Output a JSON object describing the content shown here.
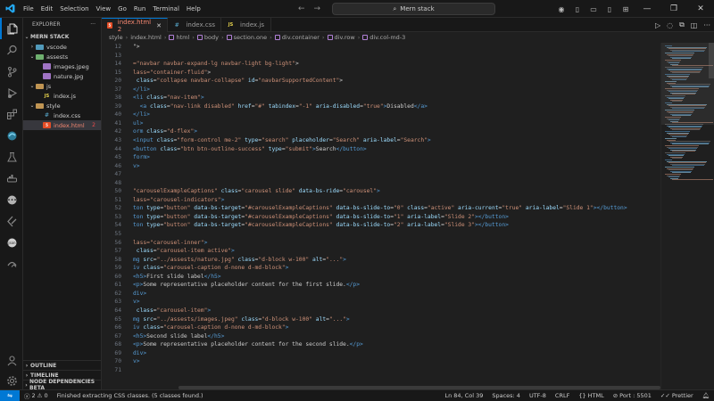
{
  "menu": [
    "File",
    "Edit",
    "Selection",
    "View",
    "Go",
    "Run",
    "Terminal",
    "Help"
  ],
  "search": {
    "text": "Mern stack"
  },
  "sidebar": {
    "title": "EXPLORER",
    "root": "MERN STACK",
    "items": [
      {
        "label": "vscode",
        "type": "folder",
        "level": 1
      },
      {
        "label": "assests",
        "type": "folder",
        "level": 1
      },
      {
        "label": "images.jpeg",
        "type": "image",
        "level": 2
      },
      {
        "label": "nature.jpg",
        "type": "image",
        "level": 2
      },
      {
        "label": "js",
        "type": "folder",
        "level": 1
      },
      {
        "label": "index.js",
        "type": "js",
        "level": 2
      },
      {
        "label": "style",
        "type": "folder",
        "level": 1
      },
      {
        "label": "index.css",
        "type": "css",
        "level": 2
      },
      {
        "label": "index.html",
        "type": "html",
        "level": 2,
        "errors": "2"
      }
    ],
    "sections": [
      "OUTLINE",
      "TIMELINE",
      "NODE DEPENDENCIES BETA"
    ]
  },
  "tabs": [
    {
      "label": "index.html 2",
      "type": "html",
      "active": true
    },
    {
      "label": "index.css",
      "type": "css",
      "active": false
    },
    {
      "label": "index.js",
      "type": "js",
      "active": false
    }
  ],
  "breadcrumb": [
    "style",
    "index.html",
    "html",
    "body",
    "section.one",
    "div.container",
    "div.row",
    "div.col-md-3"
  ],
  "code_lines": [
    {
      "n": "12",
      "parts": [
        [
          "txt",
          "\">"
        ]
      ]
    },
    {
      "n": "13",
      "parts": []
    },
    {
      "n": "14",
      "parts": [
        [
          "str",
          "=\"navbar navbar-expand-lg navbar-light bg-light\""
        ],
        [
          "txt",
          ">"
        ]
      ]
    },
    {
      "n": "15",
      "parts": [
        [
          "str",
          "lass=\"container-fluid\""
        ],
        [
          "txt",
          ">"
        ]
      ]
    },
    {
      "n": "20",
      "parts": [
        [
          "attr",
          " class"
        ],
        [
          "txt",
          "="
        ],
        [
          "str",
          "\"collapse navbar-collapse\""
        ],
        [
          "attr",
          " id"
        ],
        [
          "txt",
          "="
        ],
        [
          "str",
          "\"navbarSupportedContent\""
        ],
        [
          "txt",
          ">"
        ]
      ]
    },
    {
      "n": "37",
      "parts": [
        [
          "tag",
          "</li>"
        ]
      ]
    },
    {
      "n": "38",
      "parts": [
        [
          "tag",
          "<li"
        ],
        [
          "attr",
          " class"
        ],
        [
          "txt",
          "="
        ],
        [
          "str",
          "\"nav-item\""
        ],
        [
          "tag",
          ">"
        ]
      ]
    },
    {
      "n": "39",
      "parts": [
        [
          "tag",
          "  <a"
        ],
        [
          "attr",
          " class"
        ],
        [
          "txt",
          "="
        ],
        [
          "str",
          "\"nav-link disabled\""
        ],
        [
          "attr",
          " href"
        ],
        [
          "txt",
          "="
        ],
        [
          "str",
          "\"#\""
        ],
        [
          "attr",
          " tabindex"
        ],
        [
          "txt",
          "="
        ],
        [
          "str",
          "\"-1\""
        ],
        [
          "attr",
          " aria-disabled"
        ],
        [
          "txt",
          "="
        ],
        [
          "str",
          "\"true\""
        ],
        [
          "tag",
          ">"
        ],
        [
          "txt",
          "Disabled"
        ],
        [
          "tag",
          "</a>"
        ]
      ]
    },
    {
      "n": "40",
      "parts": [
        [
          "tag",
          "</li>"
        ]
      ]
    },
    {
      "n": "41",
      "parts": [
        [
          "tag",
          "ul>"
        ]
      ]
    },
    {
      "n": "42",
      "parts": [
        [
          "tag",
          "orm"
        ],
        [
          "attr",
          " class"
        ],
        [
          "txt",
          "="
        ],
        [
          "str",
          "\"d-flex\""
        ],
        [
          "tag",
          ">"
        ]
      ]
    },
    {
      "n": "43",
      "parts": [
        [
          "tag",
          "<input"
        ],
        [
          "attr",
          " class"
        ],
        [
          "txt",
          "="
        ],
        [
          "str",
          "\"form-control me-2\""
        ],
        [
          "attr",
          " type"
        ],
        [
          "txt",
          "="
        ],
        [
          "str",
          "\"search\""
        ],
        [
          "attr",
          " placeholder"
        ],
        [
          "txt",
          "="
        ],
        [
          "str",
          "\"Search\""
        ],
        [
          "attr",
          " aria-label"
        ],
        [
          "txt",
          "="
        ],
        [
          "str",
          "\"Search\""
        ],
        [
          "tag",
          ">"
        ]
      ]
    },
    {
      "n": "44",
      "parts": [
        [
          "tag",
          "<button"
        ],
        [
          "attr",
          " class"
        ],
        [
          "txt",
          "="
        ],
        [
          "str",
          "\"btn btn-outline-success\""
        ],
        [
          "attr",
          " type"
        ],
        [
          "txt",
          "="
        ],
        [
          "str",
          "\"submit\""
        ],
        [
          "tag",
          ">"
        ],
        [
          "txt",
          "Search"
        ],
        [
          "tag",
          "</button>"
        ]
      ]
    },
    {
      "n": "45",
      "parts": [
        [
          "tag",
          "form>"
        ]
      ]
    },
    {
      "n": "46",
      "parts": [
        [
          "tag",
          "v>"
        ]
      ]
    },
    {
      "n": "47",
      "parts": []
    },
    {
      "n": "48",
      "parts": []
    },
    {
      "n": "50",
      "parts": [
        [
          "str",
          "\"carouselExampleCaptions\""
        ],
        [
          "attr",
          " class"
        ],
        [
          "txt",
          "="
        ],
        [
          "str",
          "\"carousel slide\""
        ],
        [
          "attr",
          " data-bs-ride"
        ],
        [
          "txt",
          "="
        ],
        [
          "str",
          "\"carousel\""
        ],
        [
          "tag",
          ">"
        ]
      ]
    },
    {
      "n": "51",
      "parts": [
        [
          "str",
          "lass=\"carousel-indicators\""
        ],
        [
          "tag",
          ">"
        ]
      ]
    },
    {
      "n": "52",
      "parts": [
        [
          "tag",
          "ton"
        ],
        [
          "attr",
          " type"
        ],
        [
          "txt",
          "="
        ],
        [
          "str",
          "\"button\""
        ],
        [
          "attr",
          " data-bs-target"
        ],
        [
          "txt",
          "="
        ],
        [
          "str",
          "\"#carouselExampleCaptions\""
        ],
        [
          "attr",
          " data-bs-slide-to"
        ],
        [
          "txt",
          "="
        ],
        [
          "str",
          "\"0\""
        ],
        [
          "attr",
          " class"
        ],
        [
          "txt",
          "="
        ],
        [
          "str",
          "\"active\""
        ],
        [
          "attr",
          " aria-current"
        ],
        [
          "txt",
          "="
        ],
        [
          "str",
          "\"true\""
        ],
        [
          "attr",
          " aria-label"
        ],
        [
          "txt",
          "="
        ],
        [
          "str",
          "\"Slide 1\""
        ],
        [
          "tag",
          "></button>"
        ]
      ]
    },
    {
      "n": "53",
      "parts": [
        [
          "tag",
          "ton"
        ],
        [
          "attr",
          " type"
        ],
        [
          "txt",
          "="
        ],
        [
          "str",
          "\"button\""
        ],
        [
          "attr",
          " data-bs-target"
        ],
        [
          "txt",
          "="
        ],
        [
          "str",
          "\"#carouselExampleCaptions\""
        ],
        [
          "attr",
          " data-bs-slide-to"
        ],
        [
          "txt",
          "="
        ],
        [
          "str",
          "\"1\""
        ],
        [
          "attr",
          " aria-label"
        ],
        [
          "txt",
          "="
        ],
        [
          "str",
          "\"Slide 2\""
        ],
        [
          "tag",
          "></button>"
        ]
      ]
    },
    {
      "n": "54",
      "parts": [
        [
          "tag",
          "ton"
        ],
        [
          "attr",
          " type"
        ],
        [
          "txt",
          "="
        ],
        [
          "str",
          "\"button\""
        ],
        [
          "attr",
          " data-bs-target"
        ],
        [
          "txt",
          "="
        ],
        [
          "str",
          "\"#carouselExampleCaptions\""
        ],
        [
          "attr",
          " data-bs-slide-to"
        ],
        [
          "txt",
          "="
        ],
        [
          "str",
          "\"2\""
        ],
        [
          "attr",
          " aria-label"
        ],
        [
          "txt",
          "="
        ],
        [
          "str",
          "\"Slide 3\""
        ],
        [
          "tag",
          "></button>"
        ]
      ]
    },
    {
      "n": "55",
      "parts": []
    },
    {
      "n": "56",
      "parts": [
        [
          "str",
          "lass=\"carousel-inner\""
        ],
        [
          "tag",
          ">"
        ]
      ]
    },
    {
      "n": "57",
      "parts": [
        [
          "attr",
          " class"
        ],
        [
          "txt",
          "="
        ],
        [
          "str",
          "\"carousel-item active\""
        ],
        [
          "tag",
          ">"
        ]
      ]
    },
    {
      "n": "58",
      "parts": [
        [
          "tag",
          "mg"
        ],
        [
          "attr",
          " src"
        ],
        [
          "txt",
          "="
        ],
        [
          "str",
          "\"../assests/nature.jpg\""
        ],
        [
          "attr",
          " class"
        ],
        [
          "txt",
          "="
        ],
        [
          "str",
          "\"d-block w-100\""
        ],
        [
          "attr",
          " alt"
        ],
        [
          "txt",
          "="
        ],
        [
          "str",
          "\"...\""
        ],
        [
          "tag",
          ">"
        ]
      ]
    },
    {
      "n": "59",
      "parts": [
        [
          "tag",
          "iv"
        ],
        [
          "attr",
          " class"
        ],
        [
          "txt",
          "="
        ],
        [
          "str",
          "\"carousel-caption d-none d-md-block\""
        ],
        [
          "tag",
          ">"
        ]
      ]
    },
    {
      "n": "60",
      "parts": [
        [
          "tag",
          "<h5>"
        ],
        [
          "txt",
          "First slide label"
        ],
        [
          "tag",
          "</h5>"
        ]
      ]
    },
    {
      "n": "61",
      "parts": [
        [
          "tag",
          "<p>"
        ],
        [
          "txt",
          "Some representative placeholder content for the first slide."
        ],
        [
          "tag",
          "</p>"
        ]
      ]
    },
    {
      "n": "62",
      "parts": [
        [
          "tag",
          "div>"
        ]
      ]
    },
    {
      "n": "63",
      "parts": [
        [
          "tag",
          "v>"
        ]
      ]
    },
    {
      "n": "64",
      "parts": [
        [
          "attr",
          " class"
        ],
        [
          "txt",
          "="
        ],
        [
          "str",
          "\"carousel-item\""
        ],
        [
          "tag",
          ">"
        ]
      ]
    },
    {
      "n": "65",
      "parts": [
        [
          "tag",
          "mg"
        ],
        [
          "attr",
          " src"
        ],
        [
          "txt",
          "="
        ],
        [
          "str",
          "\"../assests/images.jpeg\""
        ],
        [
          "attr",
          " class"
        ],
        [
          "txt",
          "="
        ],
        [
          "str",
          "\"d-block w-100\""
        ],
        [
          "attr",
          " alt"
        ],
        [
          "txt",
          "="
        ],
        [
          "str",
          "\"...\""
        ],
        [
          "tag",
          ">"
        ]
      ]
    },
    {
      "n": "66",
      "parts": [
        [
          "tag",
          "iv"
        ],
        [
          "attr",
          " class"
        ],
        [
          "txt",
          "="
        ],
        [
          "str",
          "\"carousel-caption d-none d-md-block\""
        ],
        [
          "tag",
          ">"
        ]
      ]
    },
    {
      "n": "67",
      "parts": [
        [
          "tag",
          "<h5>"
        ],
        [
          "txt",
          "Second slide label"
        ],
        [
          "tag",
          "</h5>"
        ]
      ]
    },
    {
      "n": "68",
      "parts": [
        [
          "tag",
          "<p>"
        ],
        [
          "txt",
          "Some representative placeholder content for the second slide."
        ],
        [
          "tag",
          "</p>"
        ]
      ]
    },
    {
      "n": "69",
      "parts": [
        [
          "tag",
          "div>"
        ]
      ]
    },
    {
      "n": "70",
      "parts": [
        [
          "tag",
          "v>"
        ]
      ]
    },
    {
      "n": "71",
      "parts": []
    }
  ],
  "status": {
    "errors": "2",
    "warnings": "0",
    "message": "Finished extracting CSS classes. (5 classes found.)",
    "position": "Ln 84, Col 39",
    "spaces": "Spaces: 4",
    "encoding": "UTF-8",
    "eol": "CRLF",
    "language": "HTML",
    "port": "Port : 5501",
    "formatter": "Prettier"
  },
  "colors": {
    "accent": "#0078d4",
    "tag": "#569cd6",
    "attr": "#9cdcfe",
    "string": "#ce9178",
    "error": "#f48771"
  }
}
